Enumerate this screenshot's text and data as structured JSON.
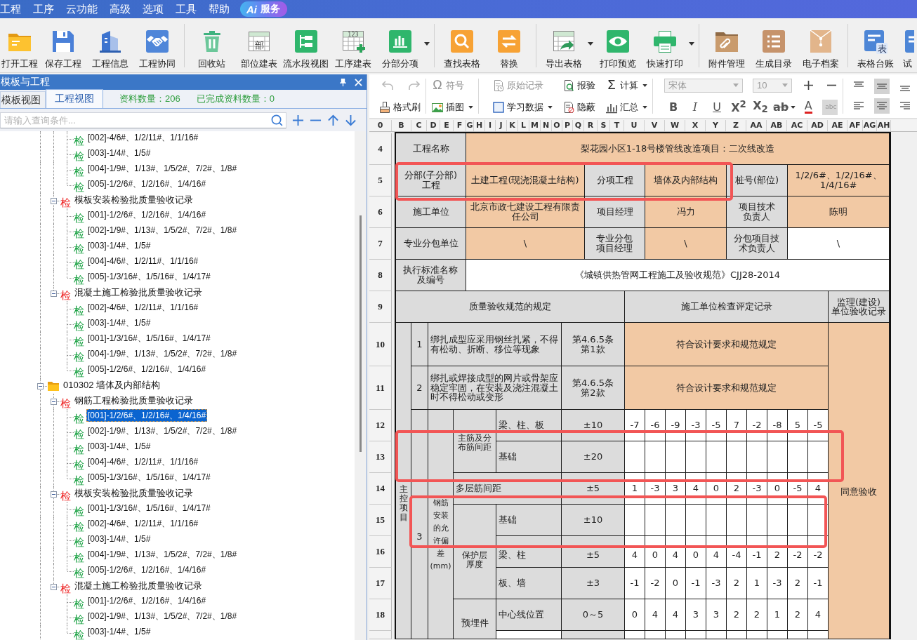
{
  "menu": {
    "items": [
      "工程",
      "工序",
      "云功能",
      "高级",
      "选项",
      "工具",
      "帮助"
    ],
    "ai_button": {
      "logo": "Ai",
      "label": "服务"
    }
  },
  "toolbar": {
    "groups": [
      [
        {
          "label": "打开工程",
          "has_menu": false
        },
        {
          "label": "保存工程",
          "has_menu": false
        },
        {
          "label": "工程信息",
          "has_menu": false
        },
        {
          "label": "工程协同",
          "has_menu": false
        }
      ],
      [
        {
          "label": "回收站",
          "has_menu": false
        },
        {
          "label": "部位建表",
          "has_menu": false,
          "icon_text": "部"
        },
        {
          "label": "流水段视图",
          "has_menu": false
        },
        {
          "label": "工序建表",
          "has_menu": false,
          "icon_text": "123"
        },
        {
          "label": "分部分项",
          "has_menu": true
        }
      ],
      [
        {
          "label": "查找表格",
          "has_menu": false
        },
        {
          "label": "替换",
          "has_menu": false
        }
      ],
      [
        {
          "label": "导出表格",
          "has_menu": true
        },
        {
          "label": "打印预览",
          "has_menu": false
        },
        {
          "label": "快速打印",
          "has_menu": true
        }
      ],
      [
        {
          "label": "附件管理",
          "has_menu": false
        },
        {
          "label": "生成目录",
          "has_menu": false
        },
        {
          "label": "电子档案",
          "has_menu": false
        }
      ],
      [
        {
          "label": "表格台账",
          "has_menu": false,
          "icon_text": "表"
        },
        {
          "label": "试",
          "has_menu": false
        }
      ]
    ]
  },
  "panel": {
    "title": "模板与工程",
    "tabs": [
      {
        "label": "模板视图",
        "selected": false
      },
      {
        "label": "工程视图",
        "selected": true
      }
    ],
    "stats": [
      "资料数量：206",
      "已完成资料数量：0"
    ],
    "search": {
      "placeholder": "请输入查询条件..."
    }
  },
  "tree": {
    "nodes": [
      {
        "children": [
          {
            "children": [
              {
                "label": "[002]-4/6#、1/2/11#、1/1/16#",
                "kind": "record",
                "mark": "检",
                "selected": false
              },
              {
                "label": "[003]-1/4#、1/5#",
                "kind": "record",
                "mark": "检",
                "selected": false
              },
              {
                "label": "[004]-1/9#、1/13#、1/5/2#、7/2#、1/8#",
                "kind": "record",
                "mark": "检",
                "selected": false
              },
              {
                "label": "[005]-1/2/6#、1/2/16#、1/4/16#",
                "kind": "record",
                "mark": "检",
                "selected": false
              }
            ]
          },
          {
            "label": "模板安装检验批质量验收记录",
            "kind": "batch",
            "mark": "检",
            "expanded": true,
            "selected": false,
            "children": [
              {
                "label": "[001]-1/2/6#、1/2/16#、1/4/16#",
                "kind": "record",
                "mark": "检",
                "selected": false
              },
              {
                "label": "[002]-1/9#、1/13#、1/5/2#、7/2#、1/8#",
                "kind": "record",
                "mark": "检",
                "selected": false
              },
              {
                "label": "[003]-1/4#、1/5#",
                "kind": "record",
                "mark": "检",
                "selected": false
              },
              {
                "label": "[004]-4/6#、1/2/11#、1/1/16#",
                "kind": "record",
                "mark": "检",
                "selected": false
              },
              {
                "label": "[005]-1/3/16#、1/5/16#、1/4/17#",
                "kind": "record",
                "mark": "检",
                "selected": false
              }
            ]
          },
          {
            "label": "混凝土施工检验批质量验收记录",
            "kind": "batch",
            "mark": "检",
            "expanded": true,
            "selected": false,
            "children": [
              {
                "label": "[002]-4/6#、1/2/11#、1/1/16#",
                "kind": "record",
                "mark": "检",
                "selected": false
              },
              {
                "label": "[003]-1/4#、1/5#",
                "kind": "record",
                "mark": "检",
                "selected": false
              },
              {
                "label": "[001]-1/3/16#、1/5/16#、1/4/17#",
                "kind": "record",
                "mark": "检",
                "selected": false
              },
              {
                "label": "[004]-1/9#、1/13#、1/5/2#、7/2#、1/8#",
                "kind": "record",
                "mark": "检",
                "selected": false
              },
              {
                "label": "[005]-1/2/6#、1/2/16#、1/4/16#",
                "kind": "record",
                "mark": "检",
                "selected": false
              }
            ]
          }
        ]
      },
      {
        "label": "010302 墙体及内部结构",
        "kind": "folder",
        "expanded": true,
        "selected": false,
        "children": [
          {
            "label": "钢筋工程检验批质量验收记录",
            "kind": "batch",
            "mark": "检",
            "expanded": true,
            "selected": false,
            "children": [
              {
                "label": "[001]-1/2/6#、1/2/16#、1/4/16#",
                "kind": "record",
                "mark": "检",
                "selected": true
              },
              {
                "label": "[002]-1/9#、1/13#、1/5/2#、7/2#、1/8#",
                "kind": "record",
                "mark": "检",
                "selected": false
              },
              {
                "label": "[003]-1/4#、1/5#",
                "kind": "record",
                "mark": "检",
                "selected": false
              },
              {
                "label": "[004]-4/6#、1/2/11#、1/1/16#",
                "kind": "record",
                "mark": "检",
                "selected": false
              },
              {
                "label": "[005]-1/3/16#、1/5/16#、1/4/17#",
                "kind": "record",
                "mark": "检",
                "selected": false
              }
            ]
          },
          {
            "label": "模板安装检验批质量验收记录",
            "kind": "batch",
            "mark": "检",
            "expanded": true,
            "selected": false,
            "children": [
              {
                "label": "[001]-1/3/16#、1/5/16#、1/4/17#",
                "kind": "record",
                "mark": "检",
                "selected": false
              },
              {
                "label": "[002]-4/6#、1/2/11#、1/1/16#",
                "kind": "record",
                "mark": "检",
                "selected": false
              },
              {
                "label": "[003]-1/4#、1/5#",
                "kind": "record",
                "mark": "检",
                "selected": false
              },
              {
                "label": "[004]-1/9#、1/13#、1/5/2#、7/2#、1/8#",
                "kind": "record",
                "mark": "检",
                "selected": false
              },
              {
                "label": "[005]-1/2/6#、1/2/16#、1/4/16#",
                "kind": "record",
                "mark": "检",
                "selected": false
              }
            ]
          },
          {
            "label": "混凝土施工检验批质量验收记录",
            "kind": "batch",
            "mark": "检",
            "expanded": true,
            "selected": false,
            "children": [
              {
                "label": "[001]-1/2/6#、1/2/16#、1/4/16#",
                "kind": "record",
                "mark": "检",
                "selected": false
              },
              {
                "label": "[002]-1/9#、1/13#、1/5/2#、7/2#、1/8#",
                "kind": "record",
                "mark": "检",
                "selected": false
              },
              {
                "label": "[003]-1/4#、1/5#",
                "kind": "record",
                "mark": "检",
                "selected": false
              }
            ]
          }
        ]
      }
    ]
  },
  "ribbon": {
    "undo": {
      "disabled": true
    },
    "redo": {
      "disabled": true
    },
    "format_painter": {
      "label": "格式刷"
    },
    "commands": [
      {
        "label": "符号",
        "glyph": "Ω",
        "has_menu": false,
        "disabled": true
      },
      {
        "label": "插图",
        "has_menu": true,
        "disabled": false
      },
      {
        "label": "原始记录",
        "has_menu": false,
        "disabled": true
      },
      {
        "label": "学习数据",
        "has_menu": true,
        "disabled": false
      },
      {
        "label": "报验",
        "has_menu": false,
        "disabled": false
      },
      {
        "label": "隐蔽",
        "has_menu": false,
        "disabled": false
      },
      {
        "label": "计算",
        "glyph": "Σ",
        "has_menu": true,
        "disabled": false
      },
      {
        "label": "汇总",
        "has_menu": true,
        "disabled": false
      }
    ],
    "font": {
      "value": "宋体",
      "disabled": true
    },
    "font_size": {
      "value": "10",
      "disabled": true
    },
    "text_styles": [
      {
        "label": "B",
        "has_menu": false,
        "disabled": false
      },
      {
        "label": "I",
        "has_menu": false,
        "disabled": false
      },
      {
        "label": "U",
        "has_menu": false,
        "disabled": false
      },
      {
        "label": "X$^{2}$",
        "has_menu": false,
        "disabled": false
      },
      {
        "label": "X$_{2}$",
        "has_menu": false,
        "disabled": false
      },
      {
        "label": "ab",
        "has_menu": true,
        "disabled": false
      },
      {
        "label": "A",
        "has_menu": false,
        "disabled": false
      },
      {
        "label": "abc",
        "has_menu": false,
        "disabled": true
      }
    ],
    "alignment": [
      {
        "selected": false
      },
      {
        "selected": true
      },
      {
        "selected": false
      },
      {
        "selected": false
      },
      {
        "selected": true
      },
      {
        "selected": false
      }
    ]
  },
  "sheet": {
    "column_headers": [
      "0",
      "B",
      "C",
      "D",
      "E",
      "F",
      "G",
      "H",
      "I",
      "J",
      "K",
      "L",
      "M",
      "N",
      "O",
      "P",
      "Q",
      "R",
      "S",
      "T",
      "U",
      "V",
      "W",
      "X",
      "Y",
      "Z",
      "AA",
      "AB",
      "AC",
      "AD",
      "AE",
      "AF",
      "AG",
      "AH"
    ],
    "rows": [
      {
        "number": "4",
        "cells": [
          {
            "text": "工程名称",
            "kind": "label",
            "colspan": 4
          },
          {
            "text": "梨花园小区1-18号楼管线改造项目：二次线改造",
            "kind": "value",
            "colspan": 15
          }
        ]
      },
      {
        "number": "5",
        "cells": [
          {
            "text": "分部(子分部)工程",
            "kind": "label",
            "colspan": 4
          },
          {
            "text": "土建工程(现浇混凝土结构)",
            "kind": "value",
            "colspan": 3
          },
          {
            "text": "分项工程",
            "kind": "label",
            "colspan": 2
          },
          {
            "text": "墙体及内部结构",
            "kind": "value",
            "colspan": 4
          },
          {
            "text": "桩号(部位)",
            "kind": "label",
            "colspan": 3
          },
          {
            "text": "1/2/6#、1/2/16#、1/4/16#",
            "kind": "value",
            "colspan": 3
          }
        ]
      },
      {
        "number": "6",
        "cells": [
          {
            "text": "施工单位",
            "kind": "label",
            "colspan": 4
          },
          {
            "text": "北京市政七建设工程有限责任公司",
            "kind": "value",
            "colspan": 3
          },
          {
            "text": "项目经理",
            "kind": "label",
            "colspan": 2
          },
          {
            "text": "冯力",
            "kind": "value",
            "colspan": 4
          },
          {
            "text": "项目技术负责人",
            "kind": "label",
            "colspan": 3
          },
          {
            "text": "陈明",
            "kind": "value",
            "colspan": 3
          }
        ]
      },
      {
        "number": "7",
        "cells": [
          {
            "text": "专业分包单位",
            "kind": "label",
            "colspan": 4
          },
          {
            "text": "\\",
            "kind": "value",
            "colspan": 3
          },
          {
            "text": "专业分包项目经理",
            "kind": "label",
            "colspan": 2
          },
          {
            "text": "\\",
            "kind": "value",
            "colspan": 4
          },
          {
            "text": "分包项目技术负责人",
            "kind": "label",
            "colspan": 3
          },
          {
            "text": "\\",
            "kind": "plain",
            "colspan": 3
          }
        ]
      },
      {
        "number": "8",
        "cells": [
          {
            "text": "执行标准名称及编号",
            "kind": "label",
            "colspan": 4
          },
          {
            "text": "《城镇供热管网工程施工及验收规范》CJJ28-2014",
            "kind": "plain",
            "colspan": 15
          }
        ]
      },
      {
        "number": "9",
        "cells": [
          {
            "text": "质量验收规范的规定",
            "kind": "label",
            "colspan": 8
          },
          {
            "text": "施工单位检查评定记录",
            "kind": "label",
            "colspan": 10
          },
          {
            "text": "监理(建设)单位验收记录",
            "kind": "label"
          }
        ]
      },
      {
        "number": "10",
        "cells": [
          {
            "text": "主控项目",
            "kind": "label",
            "rowspan": 10
          },
          {
            "text": "1",
            "kind": "label"
          },
          {
            "text": "绑扎成型应采用钢丝扎紧，不得有松动、折断、移位等现象",
            "kind": "label",
            "colspan": 4
          },
          {
            "text": "第4.6.5条第1款",
            "kind": "label",
            "colspan": 2
          },
          {
            "text": "符合设计要求和规范规定",
            "kind": "value",
            "colspan": 10
          },
          {
            "text": "同意验收",
            "kind": "value",
            "rowspan": 10
          }
        ]
      },
      {
        "number": "11",
        "cells": [
          {
            "text": "2",
            "kind": "label"
          },
          {
            "text": "绑扎或焊接成型的网片或骨架应稳定牢固，在安装及浇注混凝土时不得松动或变形",
            "kind": "label",
            "colspan": 4
          },
          {
            "text": "第4.6.5条第2款",
            "kind": "label",
            "colspan": 2
          },
          {
            "text": "符合设计要求和规范规定",
            "kind": "value",
            "colspan": 10
          }
        ]
      },
      {
        "number": "12",
        "cells": [
          {
            "text": "3",
            "kind": "label",
            "rowspan": 8
          },
          {
            "text": "钢筋安装的允许偏差(mm)",
            "kind": "label",
            "rowspan": 8
          },
          {
            "text": "主筋及分布筋间距",
            "kind": "label",
            "rowspan": 2,
            "colspan": 2
          },
          {
            "text": "梁、柱、板",
            "kind": "label"
          },
          {
            "text": "±10",
            "kind": "label",
            "colspan": 2
          },
          {
            "text": "-7",
            "kind": "plain"
          },
          {
            "text": "-6",
            "kind": "plain"
          },
          {
            "text": "-9",
            "kind": "plain"
          },
          {
            "text": "-3",
            "kind": "plain"
          },
          {
            "text": "-5",
            "kind": "plain"
          },
          {
            "text": "7",
            "kind": "plain"
          },
          {
            "text": "-2",
            "kind": "plain"
          },
          {
            "text": "-8",
            "kind": "plain"
          },
          {
            "text": "5",
            "kind": "plain"
          },
          {
            "text": "-5",
            "kind": "plain"
          }
        ]
      },
      {
        "number": "13",
        "cells": [
          {
            "text": "基础",
            "kind": "label"
          },
          {
            "text": "±20",
            "kind": "label",
            "colspan": 2
          },
          {
            "kind": "plain"
          },
          {
            "kind": "plain"
          },
          {
            "kind": "plain"
          },
          {
            "kind": "plain"
          },
          {
            "kind": "plain"
          },
          {
            "kind": "plain"
          },
          {
            "kind": "plain"
          },
          {
            "kind": "plain"
          },
          {
            "kind": "plain"
          },
          {
            "kind": "plain"
          }
        ]
      },
      {
        "number": "14",
        "cells": [
          {
            "text": "多层筋间距",
            "kind": "label",
            "colspan": 3
          },
          {
            "text": "±5",
            "kind": "label",
            "colspan": 2
          },
          {
            "text": "1",
            "kind": "plain"
          },
          {
            "text": "-3",
            "kind": "plain"
          },
          {
            "text": "3",
            "kind": "plain"
          },
          {
            "text": "4",
            "kind": "plain"
          },
          {
            "text": "0",
            "kind": "plain"
          },
          {
            "text": "2",
            "kind": "plain"
          },
          {
            "text": "-3",
            "kind": "plain"
          },
          {
            "text": "0",
            "kind": "plain"
          },
          {
            "text": "-5",
            "kind": "plain"
          },
          {
            "text": "4",
            "kind": "plain"
          }
        ]
      },
      {
        "number": "15",
        "cells": [
          {
            "text": "保护层厚度",
            "kind": "label",
            "rowspan": 3,
            "colspan": 2
          },
          {
            "text": "基础",
            "kind": "label"
          },
          {
            "text": "±10",
            "kind": "label",
            "colspan": 2
          },
          {
            "kind": "plain"
          },
          {
            "kind": "plain"
          },
          {
            "kind": "plain"
          },
          {
            "kind": "plain"
          },
          {
            "kind": "plain"
          },
          {
            "kind": "plain"
          },
          {
            "kind": "plain"
          },
          {
            "kind": "plain"
          },
          {
            "kind": "plain"
          },
          {
            "kind": "plain"
          }
        ]
      },
      {
        "number": "16",
        "cells": [
          {
            "text": "梁、柱",
            "kind": "label"
          },
          {
            "text": "±5",
            "kind": "label",
            "colspan": 2
          },
          {
            "text": "4",
            "kind": "plain"
          },
          {
            "text": "0",
            "kind": "plain"
          },
          {
            "text": "4",
            "kind": "plain"
          },
          {
            "text": "0",
            "kind": "plain"
          },
          {
            "text": "4",
            "kind": "plain"
          },
          {
            "text": "-4",
            "kind": "plain"
          },
          {
            "text": "-1",
            "kind": "plain"
          },
          {
            "text": "2",
            "kind": "plain"
          },
          {
            "text": "-2",
            "kind": "plain"
          },
          {
            "text": "-2",
            "kind": "plain"
          }
        ]
      },
      {
        "number": "17",
        "cells": [
          {
            "text": "板、墙",
            "kind": "label"
          },
          {
            "text": "±3",
            "kind": "label",
            "colspan": 2
          },
          {
            "text": "-1",
            "kind": "plain"
          },
          {
            "text": "-2",
            "kind": "plain"
          },
          {
            "text": "0",
            "kind": "plain"
          },
          {
            "text": "-1",
            "kind": "plain"
          },
          {
            "text": "-3",
            "kind": "plain"
          },
          {
            "text": "2",
            "kind": "plain"
          },
          {
            "text": "1",
            "kind": "plain"
          },
          {
            "text": "-3",
            "kind": "plain"
          },
          {
            "text": "2",
            "kind": "plain"
          },
          {
            "text": "-1",
            "kind": "plain"
          }
        ]
      },
      {
        "number": "18",
        "cells": [
          {
            "text": "预埋件",
            "kind": "label",
            "rowspan": 2,
            "colspan": 2
          },
          {
            "text": "中心线位置",
            "kind": "label"
          },
          {
            "text": "0～5",
            "kind": "label",
            "colspan": 2
          },
          {
            "text": "0",
            "kind": "plain"
          },
          {
            "text": "4",
            "kind": "plain"
          },
          {
            "text": "4",
            "kind": "plain"
          },
          {
            "text": "3",
            "kind": "plain"
          },
          {
            "text": "3",
            "kind": "plain"
          },
          {
            "text": "2",
            "kind": "plain"
          },
          {
            "text": "2",
            "kind": "plain"
          },
          {
            "text": "1",
            "kind": "plain"
          },
          {
            "text": "2",
            "kind": "plain"
          },
          {
            "text": "4",
            "kind": "plain"
          }
        ]
      },
      {
        "cells": [
          {
            "kind": "plain"
          },
          {
            "kind": "label",
            "colspan": 2
          },
          {
            "kind": "plain"
          },
          {
            "kind": "plain"
          },
          {
            "kind": "plain"
          },
          {
            "kind": "plain"
          },
          {
            "kind": "plain"
          },
          {
            "kind": "plain"
          },
          {
            "kind": "plain"
          },
          {
            "kind": "plain"
          },
          {
            "kind": "plain"
          },
          {
            "kind": "plain"
          }
        ]
      }
    ]
  }
}
